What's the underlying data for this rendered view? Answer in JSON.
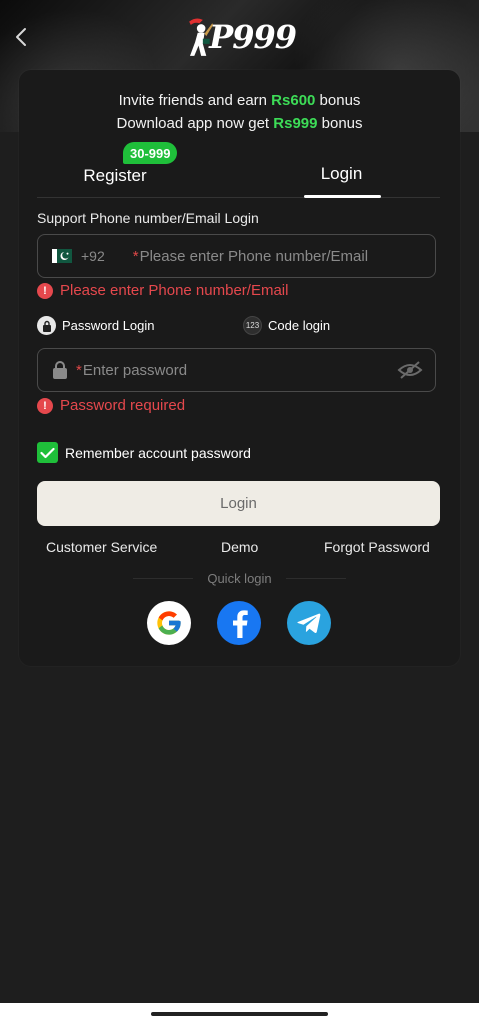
{
  "header": {
    "logo_text": "P999",
    "back_icon": "chevron-left-icon"
  },
  "promo": {
    "line1_pre": "Invite friends and earn ",
    "line1_highlight": "Rs600",
    "line1_post": " bonus",
    "line2_pre": "Download app now get ",
    "line2_highlight": "Rs999",
    "line2_post": " bonus"
  },
  "tabs": {
    "register_label": "Register",
    "register_badge": "30-999",
    "login_label": "Login",
    "active": "login"
  },
  "form": {
    "support_label": "Support Phone number/Email Login",
    "country_code": "+92",
    "phone_required_mark": "*",
    "phone_placeholder": "Please enter Phone number/Email",
    "phone_error": "Please enter Phone number/Email",
    "mode_password_label": "Password Login",
    "mode_code_label": "Code login",
    "mode_code_icon_text": "123",
    "password_required_mark": "*",
    "password_placeholder": "Enter password",
    "password_error": "Password required",
    "remember_label": "Remember account password",
    "remember_checked": true,
    "login_button": "Login"
  },
  "links": {
    "customer_service": "Customer Service",
    "demo": "Demo",
    "forgot_password": "Forgot Password"
  },
  "quick_login": {
    "label": "Quick login",
    "providers": [
      "google",
      "facebook",
      "telegram"
    ]
  },
  "colors": {
    "accent_green": "#3ddc57",
    "error_red": "#e5484d",
    "card_bg": "#1a1a1a",
    "button_bg": "#efece5"
  }
}
